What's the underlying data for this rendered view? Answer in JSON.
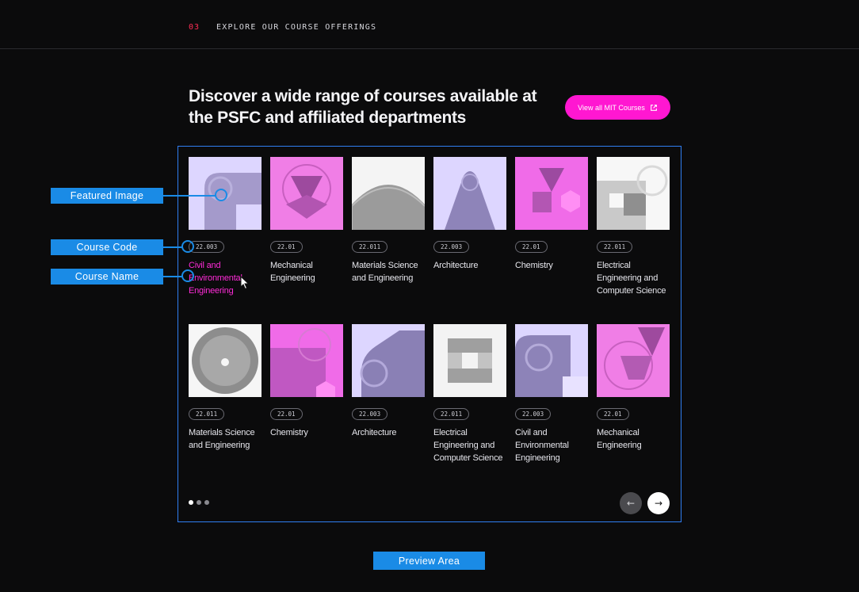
{
  "section": {
    "number": "03",
    "title": "EXPLORE OUR COURSE OFFERINGS"
  },
  "headline": "Discover a wide range of courses available at the PSFC and affiliated departments",
  "cta": {
    "label": "View all MIT Courses",
    "icon": "external-link-icon"
  },
  "colors": {
    "accent_pink": "#ff17d1",
    "annotation_blue": "#1a8be6",
    "lavender": "#ddd6ff",
    "pink": "#f06be8"
  },
  "courses": [
    {
      "code": "22.003",
      "name": "Civil and Environmental Engineering",
      "art": "rounded-corner-lavender",
      "active": true
    },
    {
      "code": "22.01",
      "name": "Mechanical Engineering",
      "art": "triangle-pink"
    },
    {
      "code": "22.011",
      "name": "Materials Science and Engineering",
      "art": "dome-white"
    },
    {
      "code": "22.003",
      "name": "Architecture",
      "art": "arch-lavender"
    },
    {
      "code": "22.01",
      "name": "Chemistry",
      "art": "hexagon-pink"
    },
    {
      "code": "22.011",
      "name": "Electrical Engineering and Computer Science",
      "art": "squares-white"
    },
    {
      "code": "22.011",
      "name": "Materials Science and Engineering",
      "art": "sphere-white"
    },
    {
      "code": "22.01",
      "name": "Chemistry",
      "art": "hexagon-pink-2"
    },
    {
      "code": "22.003",
      "name": "Architecture",
      "art": "triangle-lavender"
    },
    {
      "code": "22.011",
      "name": "Electrical Engineering and Computer Science",
      "art": "cross-white"
    },
    {
      "code": "22.003",
      "name": "Civil and Environmental Engineering",
      "art": "rounded-lavender-2"
    },
    {
      "code": "22.01",
      "name": "Mechanical Engineering",
      "art": "triangle-pink-2"
    }
  ],
  "pagination": {
    "pages": 3,
    "current": 1
  },
  "nav": {
    "prev": "←",
    "next": "→"
  },
  "annotations": {
    "featured_image": "Featured Image",
    "course_code": "Course Code",
    "course_name": "Course Name",
    "preview_area": "Preview Area"
  }
}
